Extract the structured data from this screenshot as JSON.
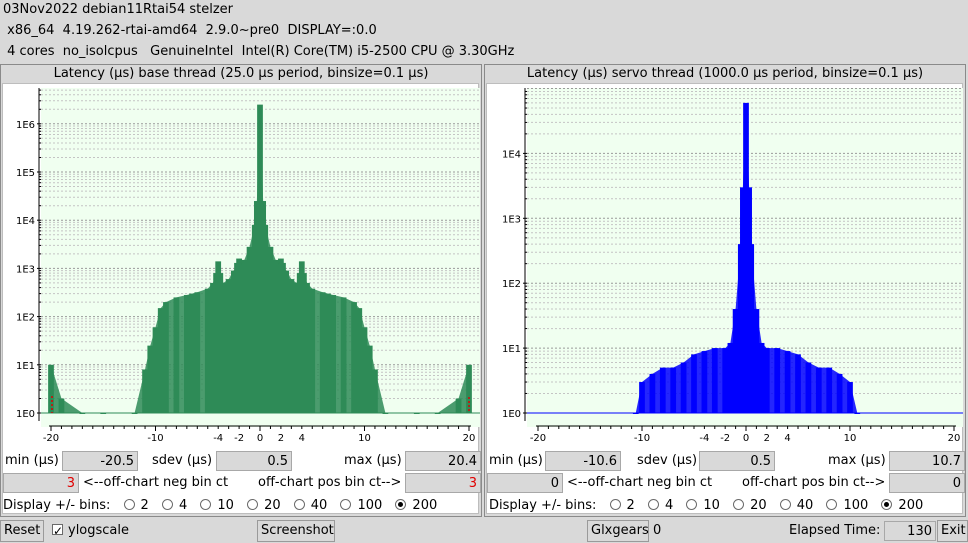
{
  "header": {
    "line1": "03Nov2022 debian11Rtai54 stelzer",
    "line2": " x86_64  4.19.262-rtai-amd64  2.9.0~pre0  DISPLAY=:0.0",
    "line3": " 4 cores  no_isolcpus   GenuineIntel  Intel(R) Core(TM) i5-2500 CPU @ 3.30GHz"
  },
  "labels": {
    "min": "min (µs)",
    "sdev": "sdev (µs)",
    "max": "max (µs)",
    "neg": "<--off-chart neg bin ct",
    "pos": "off-chart pos bin ct-->",
    "display": "Display +/- bins:"
  },
  "bins": [
    "2",
    "4",
    "10",
    "20",
    "40",
    "100",
    "200"
  ],
  "selected_bin": "200",
  "base": {
    "title": "Latency (µs) base thread (25.0 µs period, binsize=0.1 µs)",
    "min": "-20.5",
    "sdev": "0.5",
    "max": "20.4",
    "neg_ct": "3",
    "pos_ct": "3"
  },
  "servo": {
    "title": "Latency (µs) servo thread (1000.0 µs period, binsize=0.1 µs)",
    "min": "-10.6",
    "sdev": "0.5",
    "max": "10.7",
    "neg_ct": "0",
    "pos_ct": "0"
  },
  "bottom": {
    "reset": "Reset",
    "ylogscale": "ylogscale",
    "screenshot": "Screenshot",
    "glxgears": "Glxgears",
    "glx_value": "0",
    "elapsed_label": "Elapsed Time:",
    "elapsed_value": "130",
    "exit": "Exit"
  },
  "chart_data": [
    {
      "type": "bar",
      "title": "Latency (µs) base thread (25.0 µs period, binsize=0.1 µs)",
      "xlim": [
        -20,
        20
      ],
      "x_scale": "linear",
      "y_scale": "log",
      "ylim": [
        1,
        5000000
      ],
      "x_ticks": [
        "-20",
        "-10",
        "-4",
        "-2",
        "0",
        "2",
        "4",
        "10",
        "20"
      ],
      "y_ticks": [
        "1E0",
        "1E1",
        "1E2",
        "1E3",
        "1E4",
        "1E5",
        "1E6"
      ],
      "color": "#2e8b57",
      "grid": true,
      "series": [
        {
          "x": [
            -20.0,
            -19.0,
            -17.0,
            -15.0,
            -12.0,
            -11.0,
            -10.5,
            -10.0,
            -9.5,
            -9.0,
            -8.0,
            -7.0,
            -6.5,
            -6.0,
            -5.0,
            -4.5,
            -4.2,
            -4.0,
            -3.8,
            -3.5,
            -3.0,
            -2.5,
            -2.2,
            -2.0,
            -1.8,
            -1.5,
            -1.0,
            -0.5,
            -0.3,
            0.0,
            0.3,
            0.5,
            1.0,
            1.5,
            1.8,
            2.0,
            2.2,
            2.5,
            3.0,
            3.5,
            3.8,
            4.0,
            4.2,
            4.5,
            5.0,
            6.0,
            6.5,
            7.0,
            8.0,
            9.0,
            9.5,
            10.0,
            10.5,
            11.0,
            12.0,
            15.0,
            17.0,
            19.0,
            20.0
          ],
          "y": [
            10,
            2,
            1,
            1,
            1,
            8,
            25,
            60,
            150,
            200,
            250,
            280,
            300,
            320,
            380,
            500,
            800,
            1400,
            800,
            500,
            600,
            900,
            1300,
            1600,
            1200,
            1500,
            2800,
            8000,
            25000,
            2500000,
            25000,
            8000,
            2800,
            1500,
            1200,
            1600,
            1300,
            900,
            600,
            500,
            800,
            1400,
            800,
            500,
            380,
            320,
            300,
            280,
            250,
            200,
            150,
            60,
            25,
            8,
            1,
            1,
            1,
            2,
            10
          ]
        }
      ]
    },
    {
      "type": "bar",
      "title": "Latency (µs) servo thread (1000.0 µs period, binsize=0.1 µs)",
      "xlim": [
        -20,
        20
      ],
      "x_scale": "linear",
      "y_scale": "log",
      "ylim": [
        1,
        100000
      ],
      "x_ticks": [
        "-20",
        "-10",
        "-4",
        "-2",
        "0",
        "2",
        "4",
        "10",
        "20"
      ],
      "y_ticks": [
        "1E0",
        "1E1",
        "1E2",
        "1E3",
        "1E4"
      ],
      "color": "#0000ff",
      "grid": true,
      "series": [
        {
          "x": [
            -10.6,
            -10.0,
            -9.0,
            -8.0,
            -7.0,
            -6.0,
            -5.0,
            -4.0,
            -3.0,
            -2.0,
            -1.5,
            -1.0,
            -0.5,
            -0.3,
            0.0,
            0.3,
            0.5,
            1.0,
            1.5,
            2.0,
            3.0,
            4.0,
            5.0,
            6.0,
            7.0,
            8.0,
            9.0,
            10.0,
            10.7
          ],
          "y": [
            1,
            3,
            4,
            5,
            5,
            6,
            8,
            9,
            10,
            10,
            12,
            40,
            400,
            3000,
            60000,
            3000,
            400,
            40,
            12,
            10,
            10,
            9,
            8,
            6,
            5,
            5,
            4,
            3,
            1
          ]
        }
      ]
    }
  ]
}
